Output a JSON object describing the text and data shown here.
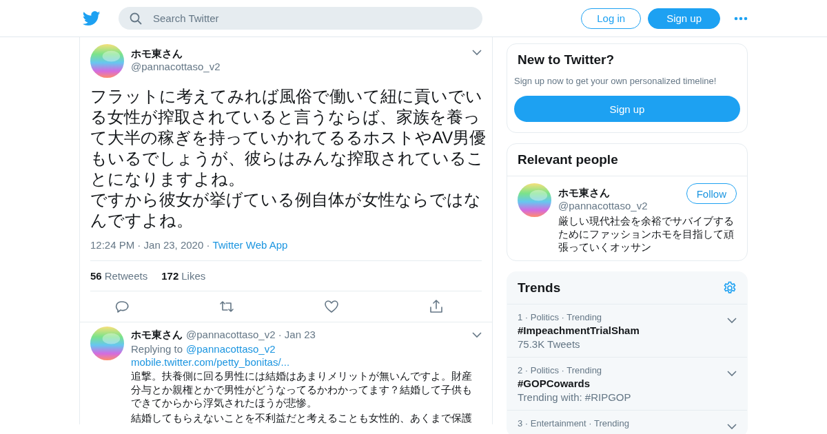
{
  "header": {
    "search": {
      "placeholder": "Search Twitter"
    },
    "buttons": [
      {
        "label": "Log in",
        "kind": "outline"
      },
      {
        "label": "Sign up",
        "kind": "filled"
      }
    ]
  },
  "tweet": {
    "name": "ホモ東さん",
    "handle": "@pannacottaso_v2",
    "text": [
      "フラットに考えてみれば風俗で働いて紐に貢いでいる女性が搾取されていると言うならば、家族を養って大半の稼ぎを持っていかれてるるホストやAV男優もいるでしょうが、彼らはみんな搾取されていることになりますよね。",
      "ですから彼女が挙げている例自体が女性ならではなんですよね。"
    ],
    "time": "12:24 PM · Jan 23, 2020 ·",
    "source": "Twitter Web App",
    "stats": [
      {
        "count": "56",
        "label": "Retweets"
      },
      {
        "count": "172",
        "label": "Likes"
      }
    ]
  },
  "reply": {
    "name": "ホモ東さん",
    "handle": "@pannacottaso_v2 · Jan 23",
    "replying_label": "Replying to",
    "replying_to": "@pannacottaso_v2",
    "link": "mobile.twitter.com/petty_bonitas/...",
    "text": [
      "追撃。扶養側に回る男性には結婚はあまりメリットが無いんですよ。財産分与とか親権とかで男性がどうなってるかわかってます？結婚して子供もできてからから浮気されたほうが悲惨。",
      "結婚してもらえないことを不利益だと考えることも女性的、あくまで保護"
    ]
  },
  "sidebar": {
    "signup_card": {
      "title": "New to Twitter?",
      "subtitle": "Sign up now to get your own personalized timeline!",
      "button": "Sign up"
    },
    "relevant": {
      "title": "Relevant people",
      "people": [
        {
          "name": "ホモ東さん",
          "handle": "@pannacottaso_v2",
          "bio": "厳しい現代社会を余裕でサバイブするためにファッションホモを目指して頑張っていくオッサン",
          "button": "Follow"
        }
      ]
    },
    "trends": {
      "title": "Trends",
      "items": [
        {
          "meta": "1 · Politics · Trending",
          "name": "#ImpeachmentTrialSham",
          "detail": "75.3K Tweets"
        },
        {
          "meta": "2 · Politics · Trending",
          "name": "#GOPCowards",
          "detail": "Trending with: #RIPGOP"
        },
        {
          "meta": "3 · Entertainment · Trending"
        }
      ]
    }
  }
}
